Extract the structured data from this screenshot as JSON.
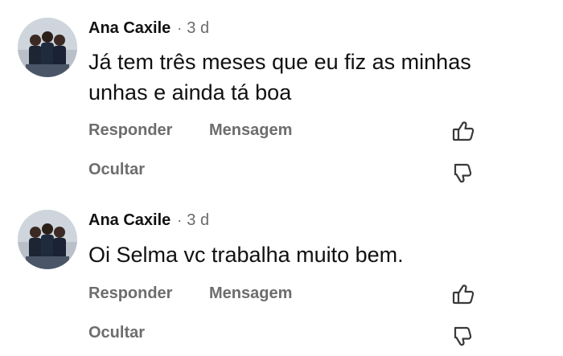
{
  "comments": [
    {
      "author": "Ana Caxile",
      "separator": "·",
      "time": "3 d",
      "text": "Já tem três meses que eu fiz as minhas unhas e ainda tá boa",
      "reply_label": "Responder",
      "message_label": "Mensagem",
      "hide_label": "Ocultar",
      "like_icon": "thumbs-up-icon",
      "dislike_icon": "thumbs-down-icon"
    },
    {
      "author": "Ana Caxile",
      "separator": "·",
      "time": "3 d",
      "text": "Oi Selma vc trabalha muito bem.",
      "reply_label": "Responder",
      "message_label": "Mensagem",
      "hide_label": "Ocultar",
      "like_icon": "thumbs-up-icon",
      "dislike_icon": "thumbs-down-icon"
    }
  ],
  "colors": {
    "author": "#111111",
    "meta": "#6b6b6b",
    "action": "#6d6d6d",
    "background": "#ffffff"
  }
}
